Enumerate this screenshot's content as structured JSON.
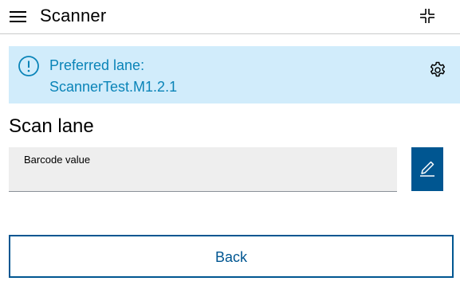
{
  "header": {
    "title": "Scanner",
    "menu_icon": "hamburger-menu-icon",
    "scan_icon": "scanner-crosshair-icon"
  },
  "banner": {
    "icon": "info-circle-icon",
    "label": "Preferred lane:",
    "value": "ScannerTest.M1.2.1",
    "settings_icon": "gear-icon"
  },
  "main": {
    "heading": "Scan lane",
    "barcode_field": {
      "label": "Barcode value",
      "value": "",
      "placeholder": ""
    },
    "edit_icon": "pen-icon",
    "back_label": "Back"
  },
  "colors": {
    "accent": "#005691",
    "banner_background": "#d1ecfb",
    "banner_text": "#0a84b8",
    "field_background": "#eeeeee"
  }
}
